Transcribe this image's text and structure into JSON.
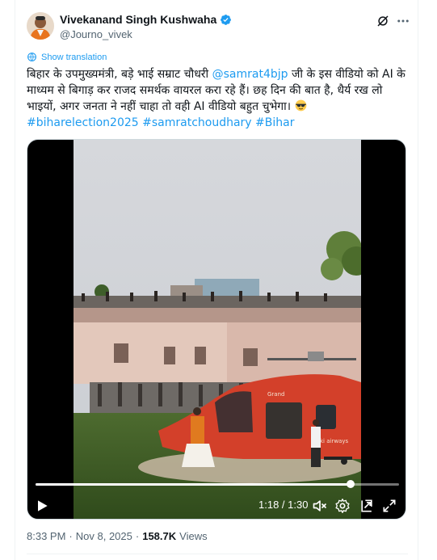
{
  "author": {
    "display_name": "Vivekanand Singh Kushwaha",
    "handle": "@Journo_vivek",
    "verified": true
  },
  "translate_label": "Show translation",
  "tweet": {
    "line1_pre": "बिहार के उपमुख्यमंत्री, बड़े भाई सम्राट चौधरी ",
    "mention": "@samrat4bjp",
    "line1_post": " जी के इस वीडियो को AI के माध्यम से बिगाड़ कर राजद समर्थक वायरल करा रहे हैं। छह दिन की बात है, धैर्य रख लो भाइयों, अगर जनता ने नहीं चाहा तो वही AI वीडियो बहुत चुभेगा। ",
    "hashtags": [
      "#biharelection2025",
      "#samratchoudhary",
      "#Bihar"
    ]
  },
  "video": {
    "elapsed": "1:18",
    "total": "1:30",
    "time_label": "1:18 / 1:30",
    "progress": 0.867,
    "heli_text_1": "Grand",
    "heli_text_2": "ki airways"
  },
  "meta": {
    "time": "8:33 PM",
    "dot": "·",
    "date": "Nov 8, 2025",
    "dot2": "·",
    "views_count": "158.7K",
    "views_label": "Views"
  },
  "colors": {
    "accent": "#1d9bf0",
    "text": "#0f1419",
    "muted": "#536471"
  }
}
